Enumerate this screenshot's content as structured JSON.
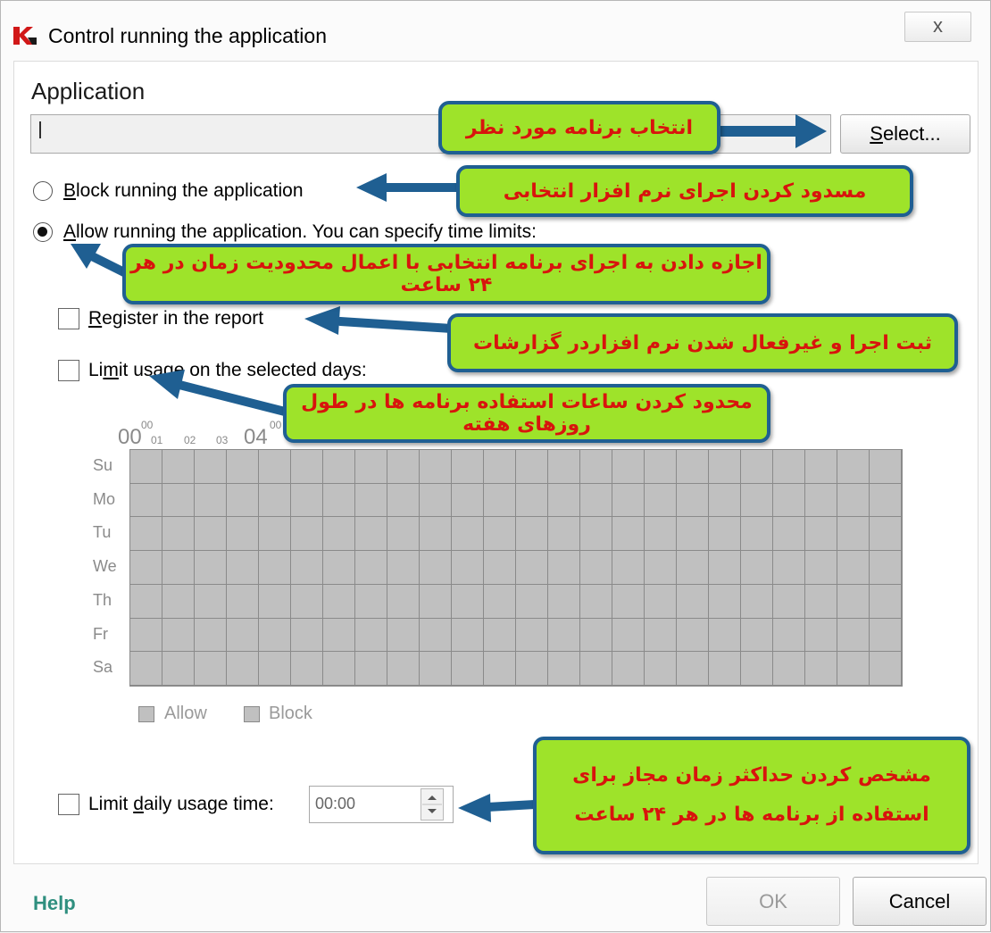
{
  "window": {
    "title": "Control running the application",
    "close_glyph": "x",
    "logo_icon": "kaspersky-k-logo-icon",
    "logo_color": "#d11818"
  },
  "application": {
    "section_title": "Application",
    "input_value": "|",
    "select_label": "Select..."
  },
  "options": {
    "block_label": "Block running the application",
    "allow_label": "Allow running the application. You can specify time limits:",
    "register_label": "Register in the report",
    "limit_days_label": "Limit usage on the selected days:",
    "daily_limit_label": "Limit daily usage time:",
    "daily_limit_value": "00:00",
    "selected_radio": "allow",
    "register_checked": false,
    "limit_days_checked": false,
    "daily_limit_checked": false
  },
  "schedule": {
    "days": [
      "Su",
      "Mo",
      "Tu",
      "We",
      "Th",
      "Fr",
      "Sa"
    ],
    "hour_labels": {
      "big_00": "00",
      "sup_00": "00",
      "h01": "01",
      "h02": "02",
      "h03": "03",
      "big_04": "04",
      "sup_04": "00"
    },
    "columns": 24,
    "legend": {
      "allow": "Allow",
      "block": "Block"
    },
    "cell_color": "#c0c0c0",
    "line_color": "#8a8a8a"
  },
  "footer": {
    "help": "Help",
    "ok": "OK",
    "cancel": "Cancel"
  },
  "callouts": {
    "select_app": "انتخاب برنامه مورد نظر",
    "block_app": "مسدود کردن اجرای نرم افزار انتخابی",
    "allow_app": "اجازه دادن به اجرای برنامه انتخابی با اعمال محدودیت زمان در هر ۲۴ ساعت",
    "register": "ثبت اجرا و غیرفعال شدن نرم افزاردر گزارشات",
    "limit_days": "محدود کردن ساعات استفاده  برنامه ها در طول روزهای هفته",
    "daily_line1": "مشخص کردن حداکثر زمان مجاز برای",
    "daily_line2": "استفاده از برنامه ها در هر ۲۴ ساعت",
    "fill_color": "#9ee32a",
    "border_color": "#1f5f92",
    "text_color": "#d8140d",
    "arrow_color": "#1f5f92"
  }
}
